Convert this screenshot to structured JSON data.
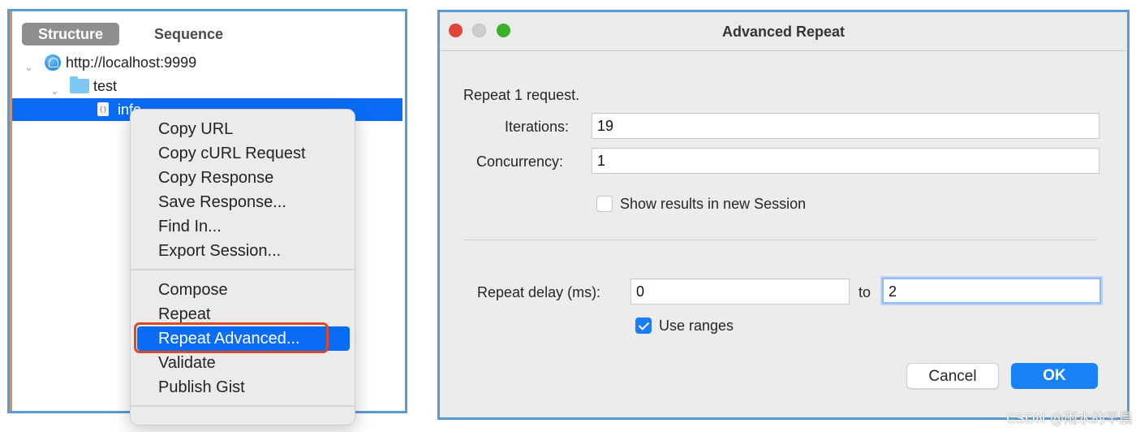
{
  "left_panel": {
    "tabs": [
      {
        "label": "Structure",
        "active": true
      },
      {
        "label": "Sequence",
        "active": false
      }
    ],
    "tree": [
      {
        "label": "http://localhost:9999",
        "icon": "globe-icon",
        "expanded": true
      },
      {
        "label": "test",
        "icon": "folder-icon",
        "expanded": true
      },
      {
        "label": "info",
        "icon": "json-file-icon",
        "selected": true
      }
    ],
    "context_menu": {
      "group1": [
        "Copy URL",
        "Copy cURL Request",
        "Copy Response",
        "Save Response...",
        "Find In...",
        "Export Session..."
      ],
      "group2": [
        "Compose",
        "Repeat",
        "Repeat Advanced...",
        "Validate",
        "Publish Gist"
      ],
      "highlighted": "Repeat Advanced..."
    },
    "highlight_color": "#0a6cf5",
    "annotation_color": "#d84a28"
  },
  "dialog": {
    "title": "Advanced Repeat",
    "summary": "Repeat 1 request.",
    "iterations_label": "Iterations:",
    "iterations_value": "19",
    "concurrency_label": "Concurrency:",
    "concurrency_value": "1",
    "show_results_label": "Show results in new Session",
    "show_results_checked": false,
    "repeat_delay_label": "Repeat delay (ms):",
    "repeat_delay_from": "0",
    "to_label": "to",
    "repeat_delay_to": "2",
    "use_ranges_label": "Use ranges",
    "use_ranges_checked": true,
    "cancel_label": "Cancel",
    "ok_label": "OK",
    "accent_color": "#1a82f7"
  },
  "watermark": "CSDN @雨水的早晨"
}
